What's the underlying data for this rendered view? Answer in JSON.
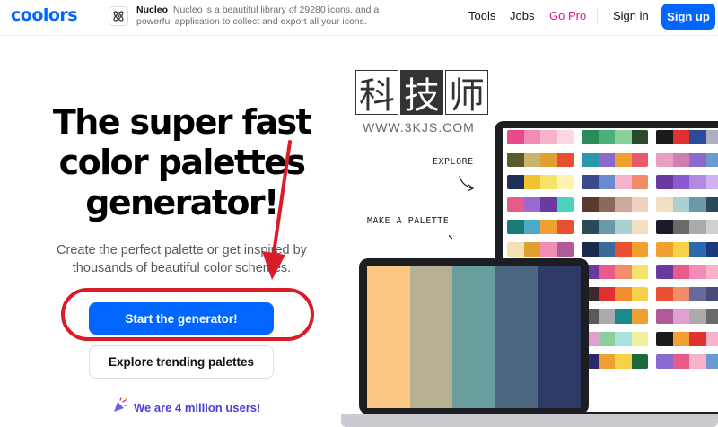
{
  "header": {
    "logo": "coolors",
    "ad": {
      "title": "Nucleo",
      "text": "Nucleo is a beautiful library of 29280 icons, and a powerful application to collect and export all your icons.",
      "icon": "nucleo-icon"
    },
    "nav": {
      "tools": "Tools",
      "jobs": "Jobs",
      "gopro": "Go Pro"
    },
    "signin": "Sign in",
    "signup": "Sign up"
  },
  "hero": {
    "title": "The super fast color palettes generator!",
    "subtitle": "Create the perfect palette or get inspired by thousands of beautiful color schemes.",
    "primary_cta": "Start the generator!",
    "secondary_cta": "Explore trending palettes",
    "users": "We are 4 million users!"
  },
  "illustration": {
    "explore_note": "EXPLORE",
    "make_note": "MAKE A PALETTE",
    "laptop_palette": [
      "#fcc684",
      "#b6af91",
      "#689e9e",
      "#4e6780",
      "#2d3a66"
    ]
  },
  "watermark": {
    "chars": [
      "科",
      "技",
      "师"
    ],
    "url": "WWW.3KJS.COM"
  },
  "colors": {
    "brand": "#0066ff",
    "gopro": "#e0148a",
    "annotation": "#d91c27",
    "users": "#4a3fd8"
  }
}
